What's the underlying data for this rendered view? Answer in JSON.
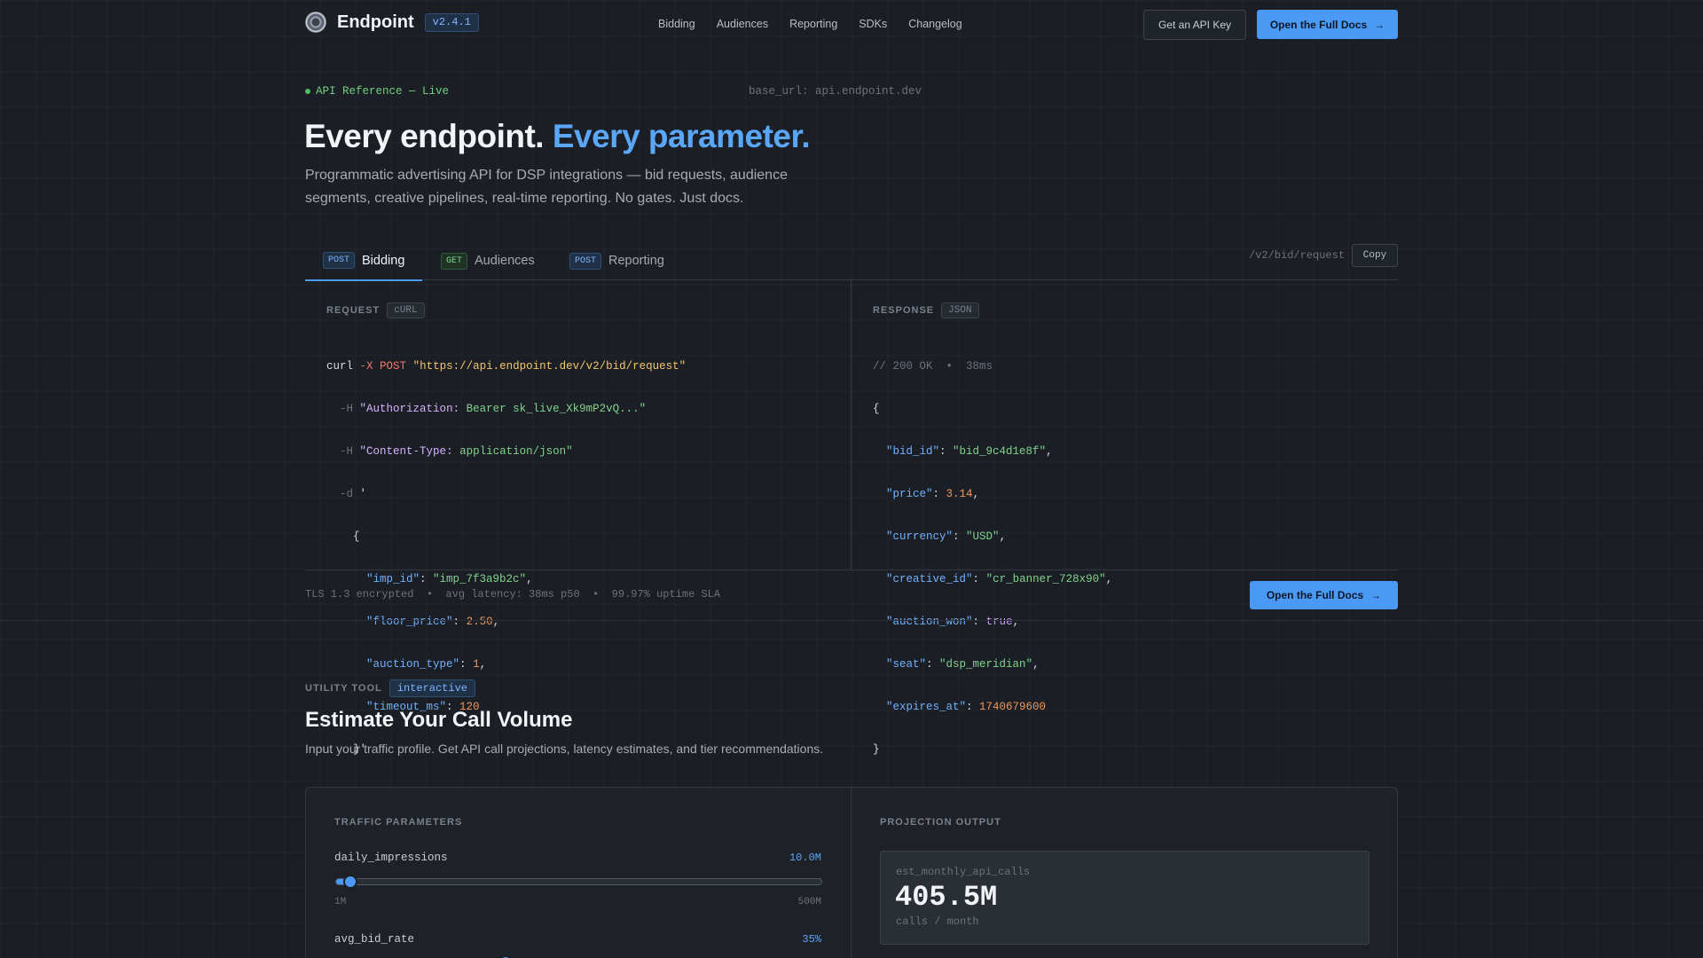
{
  "nav": {
    "brand": "Endpoint",
    "version": "v2.4.1",
    "links": [
      "Bidding",
      "Audiences",
      "Reporting",
      "SDKs",
      "Changelog"
    ],
    "api_key_button": "Get an API Key",
    "docs_button": "Open the Full Docs",
    "docs_arrow": "→"
  },
  "hero": {
    "status": "API Reference — Live",
    "base_url": "base_url: api.endpoint.dev",
    "title_white": "Every endpoint.",
    "title_blue": "Every parameter.",
    "subtitle": "Programmatic advertising API for DSP integrations — bid requests, audience segments, creative pipelines, real-time reporting. No gates. Just docs."
  },
  "tabs": [
    {
      "method": "POST",
      "label": "Bidding",
      "active": true
    },
    {
      "method": "GET",
      "label": "Audiences",
      "active": false
    },
    {
      "method": "POST",
      "label": "Reporting",
      "active": false
    }
  ],
  "endpoint_path": "/v2/bid/request",
  "copy_label": "Copy",
  "request": {
    "label": "REQUEST",
    "tag": "cURL",
    "curl_cmd": "curl",
    "method_flag": "-X POST",
    "url": "\"https://api.endpoint.dev/v2/bid/request\"",
    "header_flag": "-H",
    "auth_key": "\"Authorization:",
    "auth_val": "Bearer sk_live_Xk9mP2vQ...\"",
    "ct_key": "\"Content-Type:",
    "ct_val": "application/json\"",
    "data_flag": "-d",
    "data_open": "'",
    "body_open": "{",
    "body_close": "}'",
    "fields": [
      {
        "key": "\"imp_id\"",
        "value": "\"imp_7f3a9b2c\"",
        "type": "str",
        "comma": ","
      },
      {
        "key": "\"floor_price\"",
        "value": "2.50",
        "type": "num",
        "comma": ","
      },
      {
        "key": "\"auction_type\"",
        "value": "1",
        "type": "num",
        "comma": ","
      },
      {
        "key": "\"timeout_ms\"",
        "value": "120",
        "type": "num",
        "comma": ""
      }
    ]
  },
  "response": {
    "label": "RESPONSE",
    "tag": "JSON",
    "comment": "// 200 OK  •  38ms",
    "open": "{",
    "close": "}",
    "fields": [
      {
        "key": "\"bid_id\"",
        "value": "\"bid_9c4d1e8f\"",
        "type": "str",
        "comma": ","
      },
      {
        "key": "\"price\"",
        "value": "3.14",
        "type": "num",
        "comma": ","
      },
      {
        "key": "\"currency\"",
        "value": "\"USD\"",
        "type": "str",
        "comma": ","
      },
      {
        "key": "\"creative_id\"",
        "value": "\"cr_banner_728x90\"",
        "type": "str",
        "comma": ","
      },
      {
        "key": "\"auction_won\"",
        "value": "true",
        "type": "kw",
        "comma": ","
      },
      {
        "key": "\"seat\"",
        "value": "\"dsp_meridian\"",
        "type": "str",
        "comma": ","
      },
      {
        "key": "\"expires_at\"",
        "value": "1740679600",
        "type": "num",
        "comma": ""
      }
    ]
  },
  "footer": {
    "info": "TLS 1.3 encrypted  •  avg latency: 38ms p50  •  99.97% uptime SLA",
    "docs_button": "Open the Full Docs"
  },
  "utility": {
    "label": "UTILITY TOOL",
    "tag": "interactive",
    "title": "Estimate Your Call Volume",
    "subtitle": "Input your traffic profile. Get API call projections, latency estimates, and tier recommendations.",
    "params_head": "TRAFFIC PARAMETERS",
    "output_head": "PROJECTION OUTPUT",
    "params": [
      {
        "name": "daily_impressions",
        "value": "10.0M",
        "min_label": "1M",
        "max_label": "500M",
        "level": 0.03
      },
      {
        "name": "avg_bid_rate",
        "value": "35%",
        "level": 0.35
      }
    ],
    "projection": {
      "label": "est_monthly_api_calls",
      "value": "405.5M",
      "unit": "calls / month"
    }
  },
  "colors": {
    "accent": "#4a9af5",
    "background": "#1b1e24",
    "live_green": "#4ec063"
  }
}
